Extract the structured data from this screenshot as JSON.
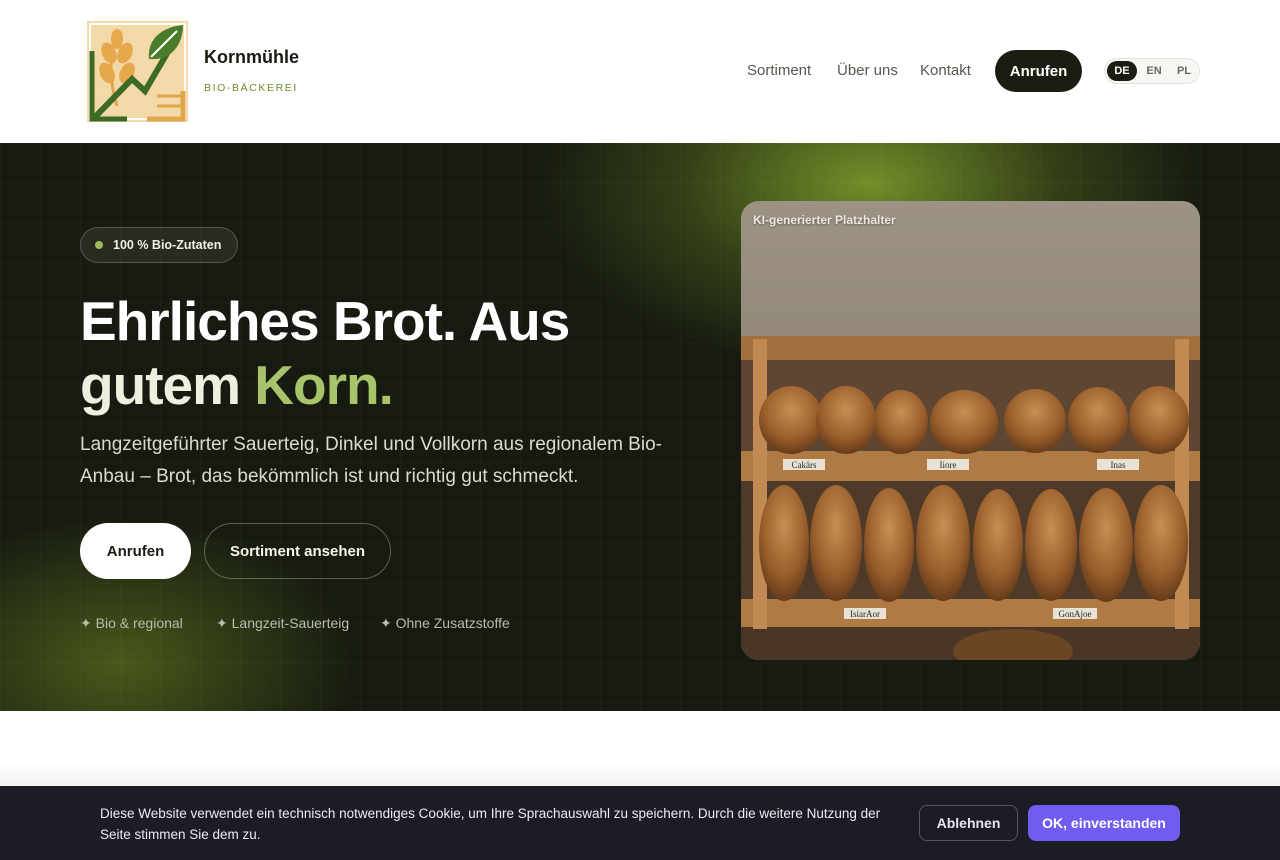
{
  "header": {
    "brand_name": "Kornmühle",
    "brand_sub": "BIO-BÄCKEREI",
    "nav": [
      "Sortiment",
      "Über uns",
      "Kontakt"
    ],
    "call_label": "Anrufen",
    "languages": [
      "DE",
      "EN",
      "PL"
    ],
    "active_language": "DE"
  },
  "hero": {
    "badge": "100 % Bio-Zutaten",
    "title_line1": "Ehrliches Brot. Aus",
    "title_line2_a": "gutem ",
    "title_line2_b": "Korn.",
    "lead": "Langzeitgeführter Sauerteig, Dinkel und Vollkorn aus regionalem Bio-Anbau – Brot, das bekömmlich ist und richtig gut schmeckt.",
    "primary_button": "Anrufen",
    "secondary_button": "Sortiment ansehen",
    "features": [
      "✦ Bio & regional",
      "✦ Langzeit-Sauerteig",
      "✦ Ohne Zusatzstoffe"
    ],
    "image_label": "KI-generierter Platzhalter",
    "shelf_labels": [
      "Cakärs",
      "Iiore",
      "Inas",
      "IsiarAor",
      "GonAjoe"
    ]
  },
  "cookie": {
    "text": "Diese Website verwendet ein technisch notwendiges Cookie, um Ihre Sprachauswahl zu speichern. Durch die weitere Nutzung der Seite stimmen Sie dem zu.",
    "decline": "Ablehnen",
    "accept": "OK, einverstanden"
  },
  "colors": {
    "accent_green": "#a8c46a",
    "dark": "#1a1d12",
    "cookie_accept": "#6f5df0"
  }
}
